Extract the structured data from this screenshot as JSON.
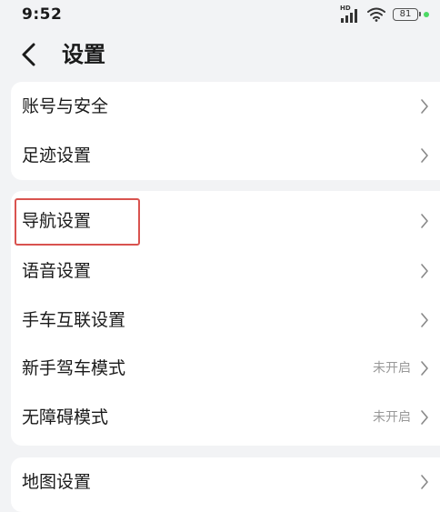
{
  "status_bar": {
    "time": "9:52",
    "network_label": "HD",
    "battery_level": "81",
    "icons": [
      "signal-icon",
      "wifi-icon",
      "battery-icon",
      "charging-dot-icon"
    ]
  },
  "header": {
    "title": "设置",
    "back_icon": "chevron-left-icon"
  },
  "groups": [
    {
      "items": [
        {
          "label": "账号与安全"
        },
        {
          "label": "足迹设置"
        }
      ]
    },
    {
      "items": [
        {
          "label": "导航设置",
          "highlighted": true
        },
        {
          "label": "语音设置"
        },
        {
          "label": "手车互联设置"
        },
        {
          "label": "新手驾车模式",
          "status": "未开启"
        },
        {
          "label": "无障碍模式",
          "status": "未开启"
        }
      ]
    },
    {
      "items": [
        {
          "label": "地图设置"
        }
      ]
    }
  ],
  "colors": {
    "background": "#f2f3f5",
    "card": "#ffffff",
    "text": "#1a1a1a",
    "secondary_text": "#999999",
    "highlight_border": "#d9534f",
    "charging": "#4cd964"
  },
  "row_icon": "chevron-right-icon"
}
